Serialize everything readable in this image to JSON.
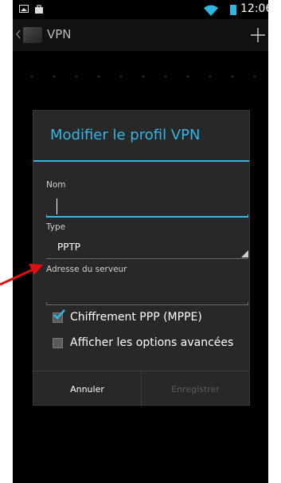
{
  "status_bar": {
    "time": "12:06",
    "icons": [
      "image-icon",
      "shopping-bag-icon",
      "wifi-icon",
      "battery-icon"
    ]
  },
  "action_bar": {
    "title": "VPN",
    "icons": [
      "back-icon",
      "app-icon",
      "add-icon"
    ]
  },
  "dialog": {
    "title": "Modifier le profil VPN",
    "name_label": "Nom",
    "name_value": "",
    "type_label": "Type",
    "type_value": "PPTP",
    "server_label": "Adresse du serveur",
    "server_value": "",
    "encryption_label": "Chiffrement PPP (MPPE)",
    "encryption_checked": true,
    "advanced_label": "Afficher les options avancées",
    "advanced_checked": false,
    "cancel_label": "Annuler",
    "save_label": "Enregistrer"
  },
  "colors": {
    "accent": "#33b5e5",
    "dialog_bg": "#282828",
    "annotation_arrow": "#e01010"
  }
}
